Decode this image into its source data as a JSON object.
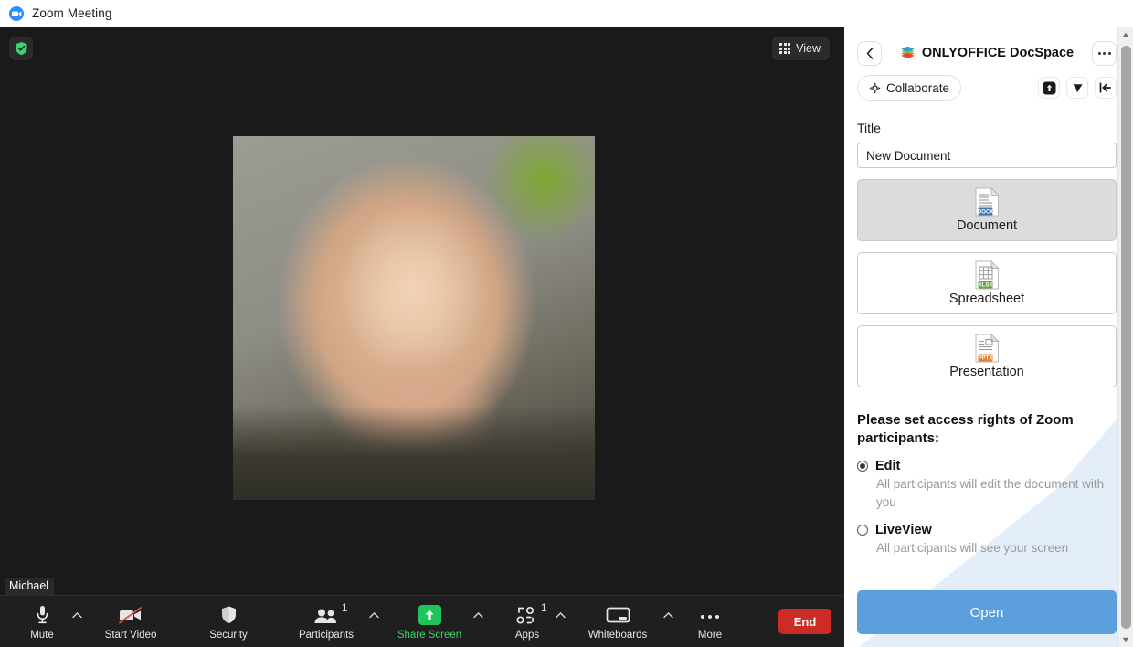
{
  "window": {
    "title": "Zoom Meeting",
    "app_icon": "zoom-logo-icon"
  },
  "stage": {
    "encryption_icon": "green-shield-check-icon",
    "view_button": {
      "label": "View",
      "icon": "grid-icon"
    },
    "participant_name": "Michael"
  },
  "controls": {
    "items": [
      {
        "label": "Mute",
        "icon": "microphone-icon",
        "has_caret": true,
        "count": "",
        "accent": "default"
      },
      {
        "label": "Start Video",
        "icon": "video-off-icon",
        "has_caret": false,
        "count": "",
        "accent": "default"
      },
      {
        "label": "Security",
        "icon": "shield-icon",
        "has_caret": false,
        "count": "",
        "accent": "default"
      },
      {
        "label": "Participants",
        "icon": "people-icon",
        "has_caret": true,
        "count": "1",
        "accent": "default"
      },
      {
        "label": "Share Screen",
        "icon": "share-screen-icon",
        "has_caret": true,
        "count": "",
        "accent": "green"
      },
      {
        "label": "Apps",
        "icon": "apps-icon",
        "has_caret": true,
        "count": "1",
        "accent": "default"
      },
      {
        "label": "Whiteboards",
        "icon": "whiteboard-icon",
        "has_caret": true,
        "count": "",
        "accent": "default"
      },
      {
        "label": "More",
        "icon": "ellipsis-icon",
        "has_caret": false,
        "count": "",
        "accent": "default"
      }
    ],
    "end_button": "End"
  },
  "panel": {
    "back_icon": "chevron-left-icon",
    "title": "ONLYOFFICE DocSpace",
    "logo_icon": "onlyoffice-layers-icon",
    "more_icon": "ellipsis-icon",
    "collaborate_button": {
      "label": "Collaborate",
      "icon": "collaborate-diamond-icon"
    },
    "action_buttons": [
      {
        "name": "upload-icon",
        "label": ""
      },
      {
        "name": "cursor-pointer-icon",
        "label": ""
      },
      {
        "name": "collapse-panel-icon",
        "label": ""
      }
    ],
    "form": {
      "title_label": "Title",
      "title_value": "New Document",
      "title_placeholder": "New Document",
      "doc_types": [
        {
          "label": "Document",
          "badge": "DOCX",
          "badge_color": "#3c78b4",
          "selected": true
        },
        {
          "label": "Spreadsheet",
          "badge": "XLSX",
          "badge_color": "#69a43c",
          "selected": false
        },
        {
          "label": "Presentation",
          "badge": "PPTX",
          "badge_color": "#e8802a",
          "selected": false
        }
      ],
      "access_title": "Please set access rights of Zoom participants:",
      "options": [
        {
          "label": "Edit",
          "description": "All participants will edit the document with you",
          "selected": true
        },
        {
          "label": "LiveView",
          "description": "All participants will see your screen",
          "selected": false
        }
      ],
      "open_button": "Open"
    }
  },
  "colors": {
    "zoom_blue": "#2d8cff",
    "end_red": "#cc2b26",
    "share_green": "#20c45c",
    "open_blue": "#5ba0dd",
    "panel_decoration": "#e3eef8"
  }
}
